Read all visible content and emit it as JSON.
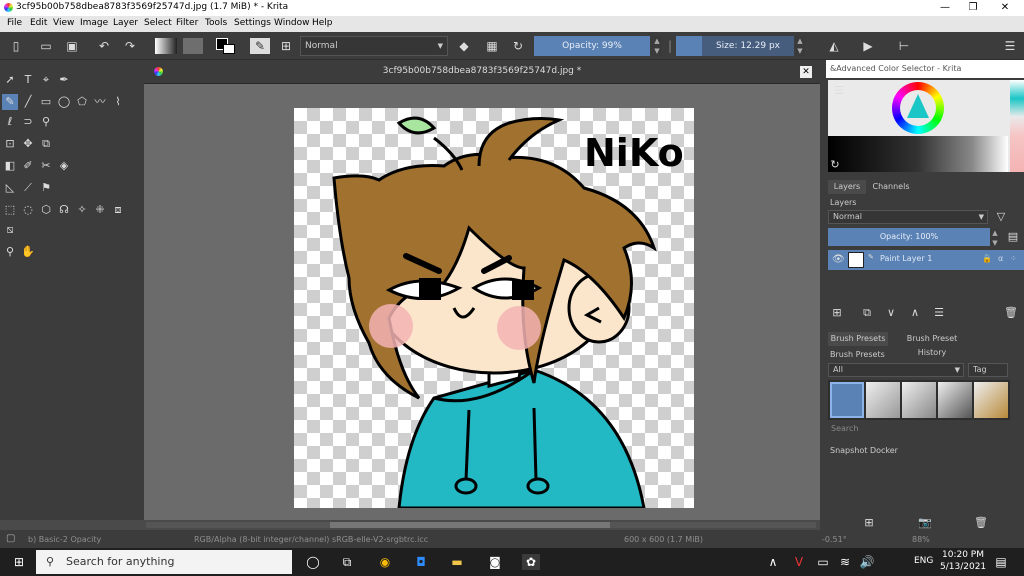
{
  "window": {
    "title": "3cf95b00b758dbea8783f3569f25747d.jpg (1.7 MiB)  * - Krita"
  },
  "menu": [
    "File",
    "Edit",
    "View",
    "Image",
    "Layer",
    "Select",
    "Filter",
    "Tools",
    "Settings",
    "Window",
    "Help"
  ],
  "toolbar": {
    "blend_mode": "Normal",
    "opacity": "Opacity: 99%",
    "size": "Size: 12.29 px"
  },
  "document": {
    "tab_title": "3cf95b00b758dbea8783f3569f25747d.jpg *",
    "drawing_text": "NiKo"
  },
  "color_selector": {
    "title": "&Advanced Color Selector - Krita"
  },
  "layers": {
    "tabs": [
      "Layers",
      "Channels"
    ],
    "title": "Layers",
    "blend_mode": "Normal",
    "opacity": "Opacity:  100%",
    "items": [
      {
        "name": "Paint Layer 1"
      }
    ]
  },
  "brush": {
    "tabs": [
      "Brush Presets",
      "Brush Preset History"
    ],
    "title": "Brush Presets",
    "filter": "All",
    "tag": "Tag",
    "search_placeholder": "Search"
  },
  "snapshot": {
    "title": "Snapshot Docker"
  },
  "status": {
    "brush": "b) Basic-2 Opacity",
    "color_space": "RGB/Alpha (8-bit integer/channel)  sRGB-elle-V2-srgbtrc.icc",
    "image_size": "600 x 600 (1.7 MiB)",
    "rotation": "-0.51°",
    "zoom": "88%"
  },
  "taskbar": {
    "search_placeholder": "Search for anything",
    "language": "ENG",
    "time": "10:20 PM",
    "date": "5/13/2021"
  },
  "colors": {
    "accent": "#5b82b5",
    "hoodie": "#22b8c4",
    "hair": "#a0712f",
    "skin": "#fbe6cc",
    "blush": "#f3b3b3"
  }
}
